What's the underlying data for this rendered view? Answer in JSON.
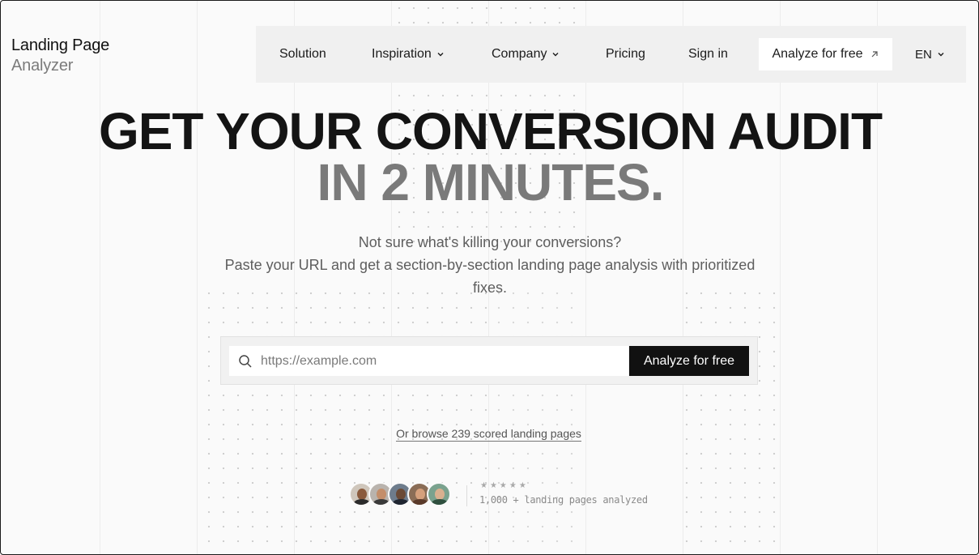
{
  "brand": {
    "line1": "Landing Page",
    "line2": "Analyzer"
  },
  "nav": {
    "items": [
      {
        "label": "Solution",
        "has_dropdown": false
      },
      {
        "label": "Inspiration",
        "has_dropdown": true
      },
      {
        "label": "Company",
        "has_dropdown": true
      },
      {
        "label": "Pricing",
        "has_dropdown": false
      },
      {
        "label": "Sign in",
        "has_dropdown": false
      }
    ],
    "cta_label": "Analyze for free",
    "cta_icon": "arrow-up-right-icon",
    "language": "EN"
  },
  "hero": {
    "title_line1": "GET YOUR CONVERSION AUDIT",
    "title_line2": "IN 2 MINUTES.",
    "subtitle_line1": "Not sure what's killing your conversions?",
    "subtitle_line2": "Paste your URL and get a section-by-section landing page analysis with prioritized fixes."
  },
  "search": {
    "placeholder": "https://example.com",
    "button_label": "Analyze for free",
    "icon": "search-icon"
  },
  "browse_link": "Or browse 239 scored landing pages",
  "social_proof": {
    "stars": "★★★★★",
    "text": "1,000 + landing pages analyzed",
    "avatar_count": 5
  },
  "colors": {
    "background": "#fafafa",
    "nav_background": "#f0f0f0",
    "primary_button": "#111111",
    "heading": "#141414",
    "heading_muted": "#7a7a7a"
  }
}
